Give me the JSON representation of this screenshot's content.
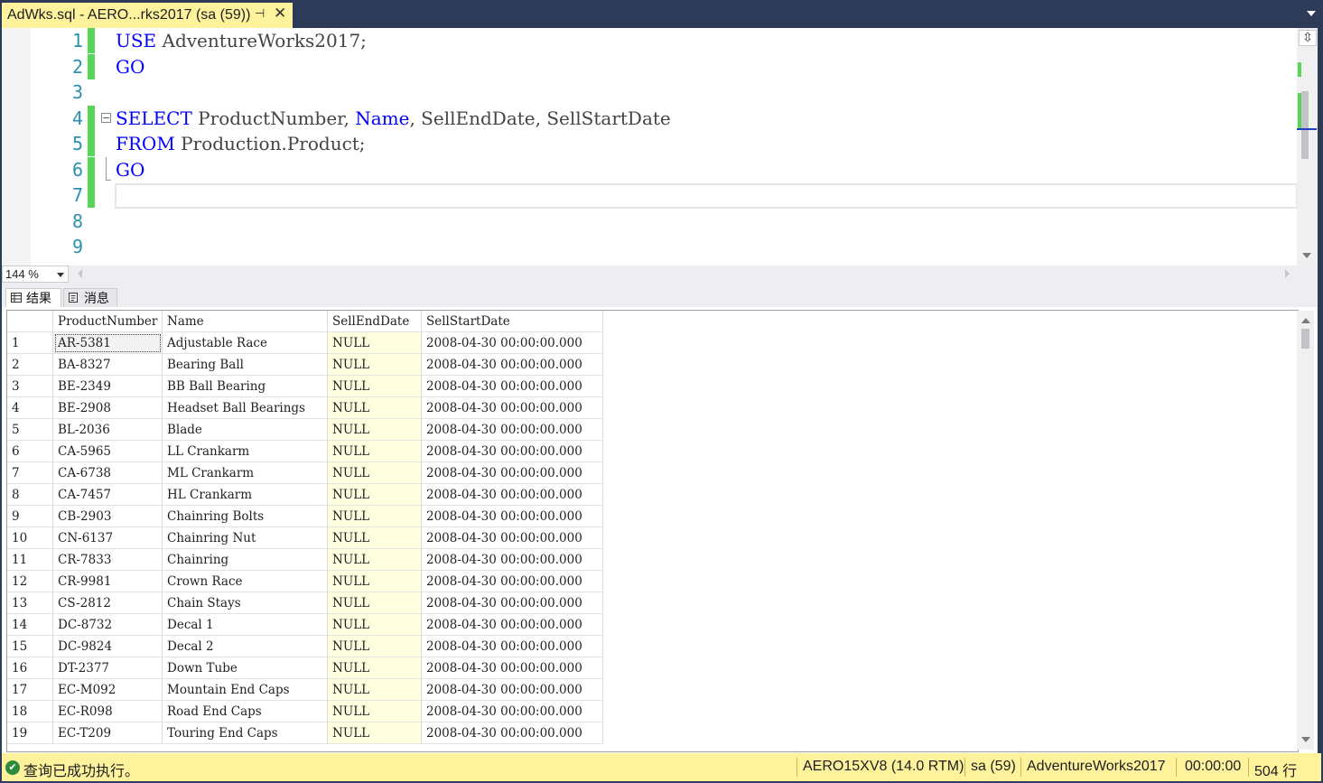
{
  "document_tab": {
    "title": "AdWks.sql - AERO...rks2017 (sa (59))",
    "pin_glyph": "⊣",
    "close_glyph": "✕"
  },
  "editor": {
    "line_numbers": [
      "1",
      "2",
      "3",
      "4",
      "5",
      "6",
      "7",
      "8",
      "9"
    ],
    "lines": [
      [
        {
          "t": "USE",
          "kw": true
        },
        {
          "t": " AdventureWorks2017;",
          "kw": false
        }
      ],
      [
        {
          "t": "GO",
          "kw": true
        }
      ],
      [],
      [
        {
          "t": "SELECT",
          "kw": true
        },
        {
          "t": " ProductNumber, ",
          "kw": false
        },
        {
          "t": "Name",
          "kw": true
        },
        {
          "t": ", SellEndDate, SellStartDate",
          "kw": false
        }
      ],
      [
        {
          "t": "FROM",
          "kw": true
        },
        {
          "t": " Production.Product;",
          "kw": false
        }
      ],
      [
        {
          "t": "GO",
          "kw": true
        }
      ],
      [],
      [],
      []
    ],
    "colors": {
      "keyword": "#0000ff",
      "line_number": "#2b91af",
      "change_marker": "#57d658"
    }
  },
  "zoom": {
    "value": "144 %"
  },
  "results_tabs": {
    "results_label": "结果",
    "messages_label": "消息"
  },
  "grid": {
    "columns": [
      "",
      "ProductNumber",
      "Name",
      "SellEndDate",
      "SellStartDate"
    ],
    "rows": [
      [
        "1",
        "AR-5381",
        "Adjustable Race",
        "NULL",
        "2008-04-30 00:00:00.000"
      ],
      [
        "2",
        "BA-8327",
        "Bearing Ball",
        "NULL",
        "2008-04-30 00:00:00.000"
      ],
      [
        "3",
        "BE-2349",
        "BB Ball Bearing",
        "NULL",
        "2008-04-30 00:00:00.000"
      ],
      [
        "4",
        "BE-2908",
        "Headset Ball Bearings",
        "NULL",
        "2008-04-30 00:00:00.000"
      ],
      [
        "5",
        "BL-2036",
        "Blade",
        "NULL",
        "2008-04-30 00:00:00.000"
      ],
      [
        "6",
        "CA-5965",
        "LL Crankarm",
        "NULL",
        "2008-04-30 00:00:00.000"
      ],
      [
        "7",
        "CA-6738",
        "ML Crankarm",
        "NULL",
        "2008-04-30 00:00:00.000"
      ],
      [
        "8",
        "CA-7457",
        "HL Crankarm",
        "NULL",
        "2008-04-30 00:00:00.000"
      ],
      [
        "9",
        "CB-2903",
        "Chainring Bolts",
        "NULL",
        "2008-04-30 00:00:00.000"
      ],
      [
        "10",
        "CN-6137",
        "Chainring Nut",
        "NULL",
        "2008-04-30 00:00:00.000"
      ],
      [
        "11",
        "CR-7833",
        "Chainring",
        "NULL",
        "2008-04-30 00:00:00.000"
      ],
      [
        "12",
        "CR-9981",
        "Crown Race",
        "NULL",
        "2008-04-30 00:00:00.000"
      ],
      [
        "13",
        "CS-2812",
        "Chain Stays",
        "NULL",
        "2008-04-30 00:00:00.000"
      ],
      [
        "14",
        "DC-8732",
        "Decal 1",
        "NULL",
        "2008-04-30 00:00:00.000"
      ],
      [
        "15",
        "DC-9824",
        "Decal 2",
        "NULL",
        "2008-04-30 00:00:00.000"
      ],
      [
        "16",
        "DT-2377",
        "Down Tube",
        "NULL",
        "2008-04-30 00:00:00.000"
      ],
      [
        "17",
        "EC-M092",
        "Mountain End Caps",
        "NULL",
        "2008-04-30 00:00:00.000"
      ],
      [
        "18",
        "EC-R098",
        "Road End Caps",
        "NULL",
        "2008-04-30 00:00:00.000"
      ],
      [
        "19",
        "EC-T209",
        "Touring End Caps",
        "NULL",
        "2008-04-30 00:00:00.000"
      ]
    ],
    "null_cell_color": "#fffedf"
  },
  "status": {
    "message": "查询已成功执行。",
    "server": "AERO15XV8 (14.0 RTM)",
    "user": "sa (59)",
    "database": "AdventureWorks2017",
    "elapsed": "00:00:00",
    "row_count": "504 行",
    "bar_color": "#fff29d"
  }
}
